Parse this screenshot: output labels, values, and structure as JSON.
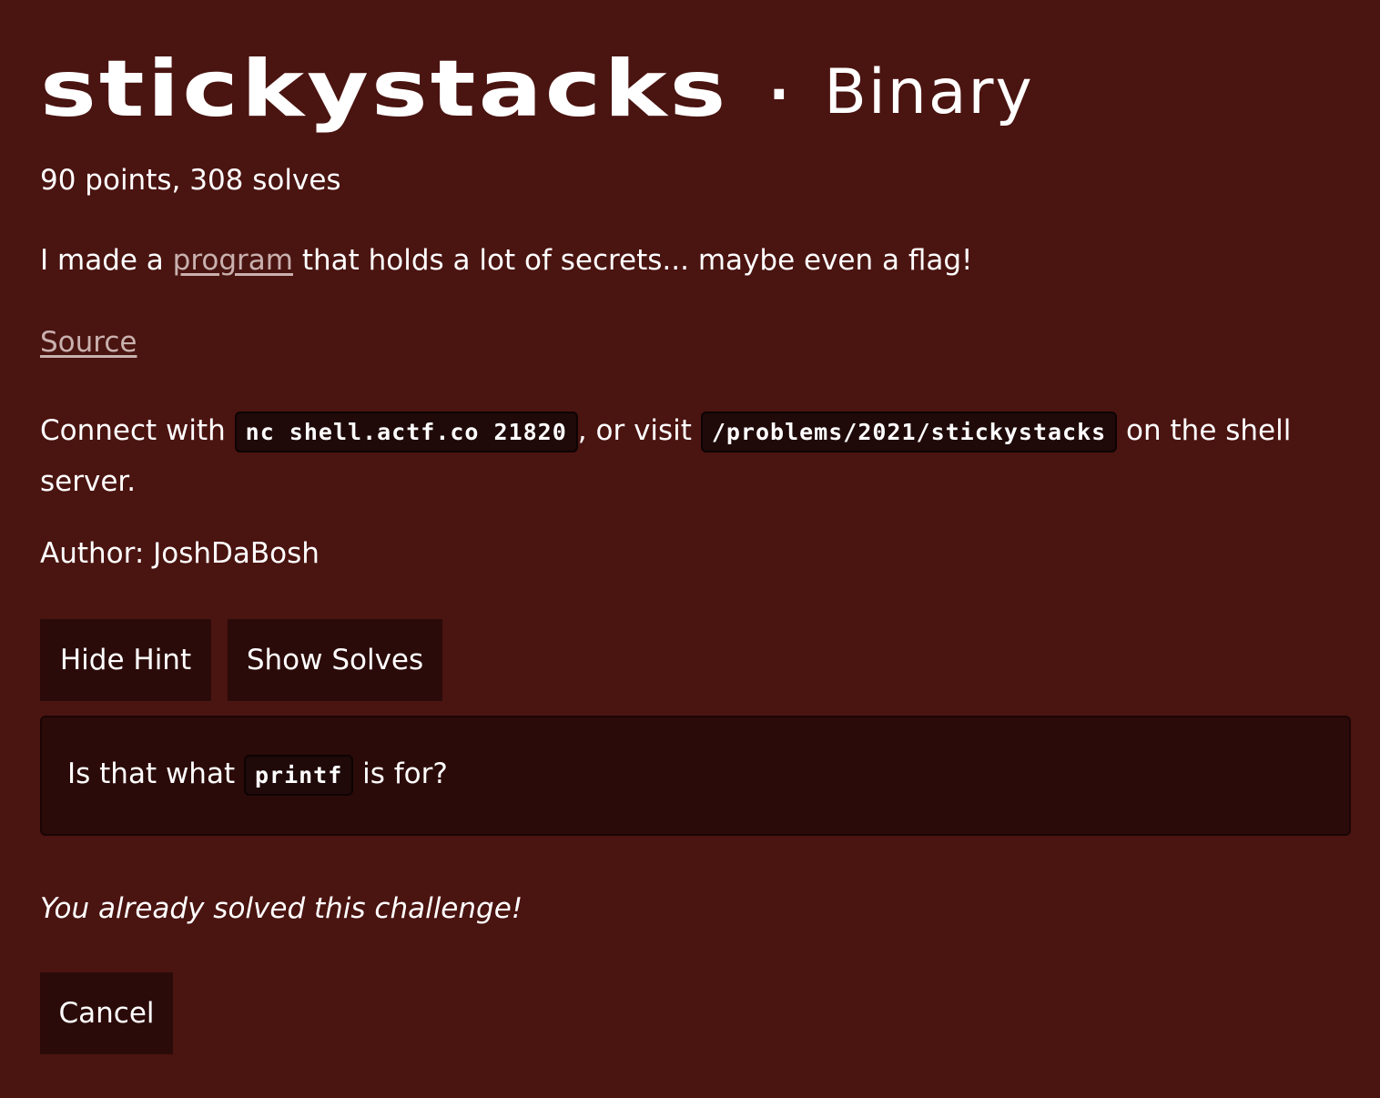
{
  "challenge": {
    "name": "stickystacks",
    "separator": "·",
    "category": "Binary",
    "stats": "90 points, 308 solves",
    "description": {
      "before": "I made a ",
      "link": "program",
      "after": " that holds a lot of secrets... maybe even a flag!"
    },
    "source_link": "Source",
    "connect": {
      "prefix": "Connect with ",
      "command": "nc shell.actf.co 21820",
      "middle": ", or visit ",
      "path": "/problems/2021/stickystacks",
      "suffix": " on the shell server."
    },
    "author": "Author: JoshDaBosh"
  },
  "buttons": {
    "hide_hint": "Hide Hint",
    "show_solves": "Show Solves",
    "cancel": "Cancel"
  },
  "hint": {
    "before": "Is that what ",
    "code": "printf",
    "after": " is for?"
  },
  "status": "You already solved this challenge!",
  "colors": {
    "background": "#4a1411",
    "button_bg": "#2b0b09",
    "link": "#c9b1ae",
    "code_bg": "#1f0909"
  }
}
